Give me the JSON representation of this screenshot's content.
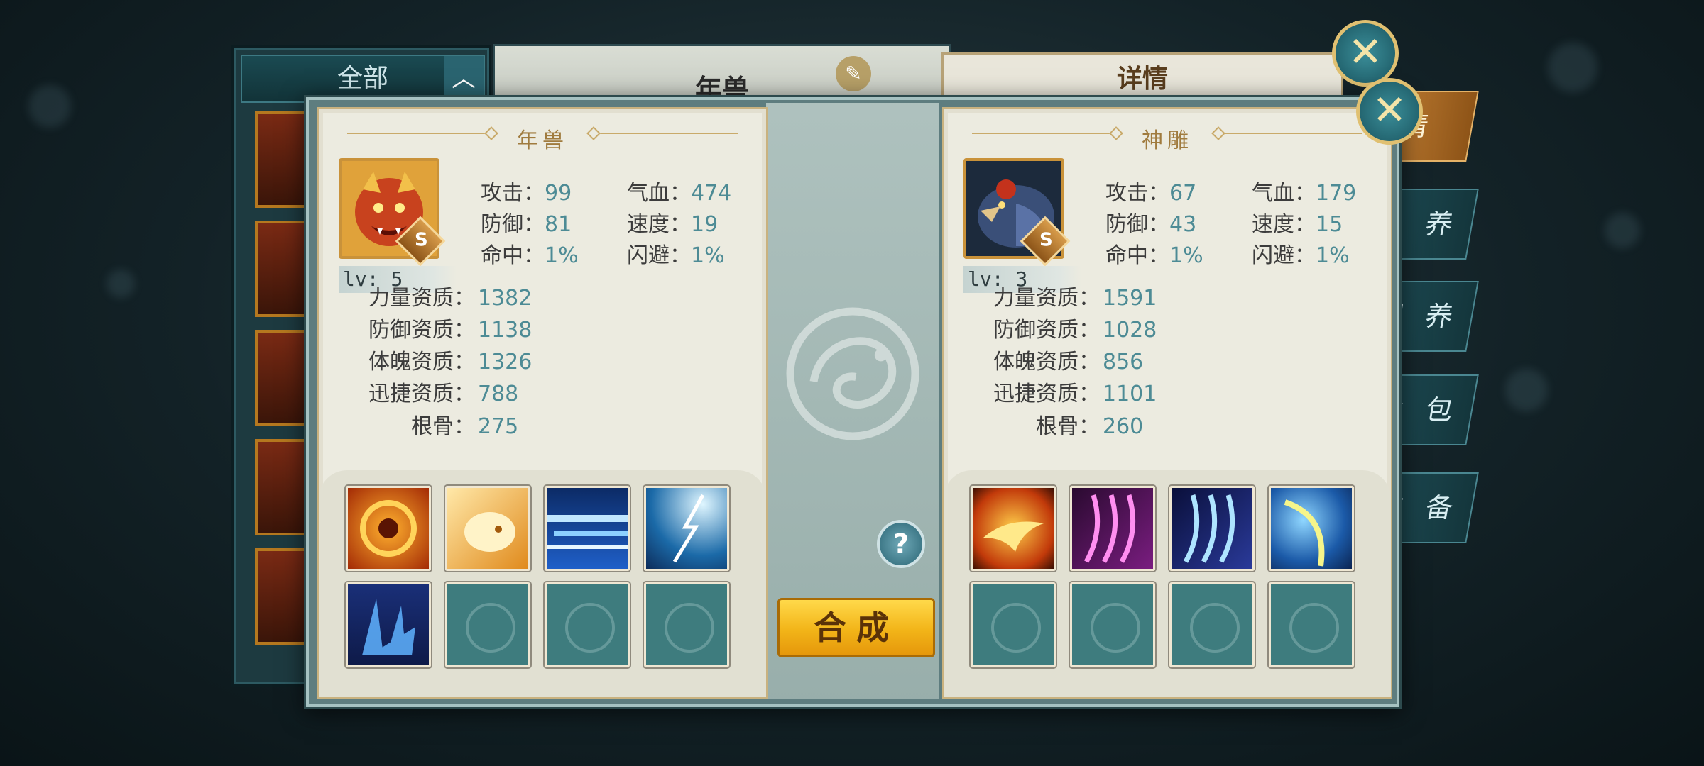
{
  "background": {
    "list_header": {
      "label": "全部",
      "collapse_icon": "chevron-up-icon"
    },
    "center_title": "年兽",
    "center_edit_icon": "edit-icon",
    "detail_title": "详情",
    "side_tabs": [
      "情",
      "眼 养",
      "训 养",
      "背 包",
      "装 备"
    ]
  },
  "dialog": {
    "left_pet": {
      "name": "年兽",
      "grade": "S",
      "level": "lv: 5",
      "stats": [
        {
          "label": "攻击：",
          "value": "99"
        },
        {
          "label": "气血：",
          "value": "474"
        },
        {
          "label": "防御：",
          "value": "81"
        },
        {
          "label": "速度：",
          "value": "19"
        },
        {
          "label": "命中：",
          "value": "1%"
        },
        {
          "label": "闪避：",
          "value": "1%"
        }
      ],
      "aptitudes": [
        {
          "label": "力量资质：",
          "value": "1382"
        },
        {
          "label": "防御资质：",
          "value": "1138"
        },
        {
          "label": "体魄资质：",
          "value": "1326"
        },
        {
          "label": "迅捷资质：",
          "value": "788"
        },
        {
          "label": "根骨：",
          "value": "275"
        }
      ],
      "skills": [
        "fire-orb-skill-icon",
        "golden-lion-skill-icon",
        "light-dash-skill-icon",
        "lightning-skill-icon",
        "ice-shard-skill-icon",
        "empty",
        "empty",
        "empty"
      ]
    },
    "right_pet": {
      "name": "神雕",
      "grade": "S",
      "level": "lv: 3",
      "stats": [
        {
          "label": "攻击：",
          "value": "67"
        },
        {
          "label": "气血：",
          "value": "179"
        },
        {
          "label": "防御：",
          "value": "43"
        },
        {
          "label": "速度：",
          "value": "15"
        },
        {
          "label": "命中：",
          "value": "1%"
        },
        {
          "label": "闪避：",
          "value": "1%"
        }
      ],
      "aptitudes": [
        {
          "label": "力量资质：",
          "value": "1591"
        },
        {
          "label": "防御资质：",
          "value": "1028"
        },
        {
          "label": "体魄资质：",
          "value": "856"
        },
        {
          "label": "迅捷资质：",
          "value": "1101"
        },
        {
          "label": "根骨：",
          "value": "260"
        }
      ],
      "skills": [
        "phoenix-skill-icon",
        "pink-claw-skill-icon",
        "blue-claw-skill-icon",
        "wind-slash-skill-icon",
        "empty",
        "empty",
        "empty",
        "empty"
      ]
    },
    "help_label": "?",
    "merge_label": "合成"
  },
  "close_icons": [
    "close-icon",
    "close-icon"
  ]
}
